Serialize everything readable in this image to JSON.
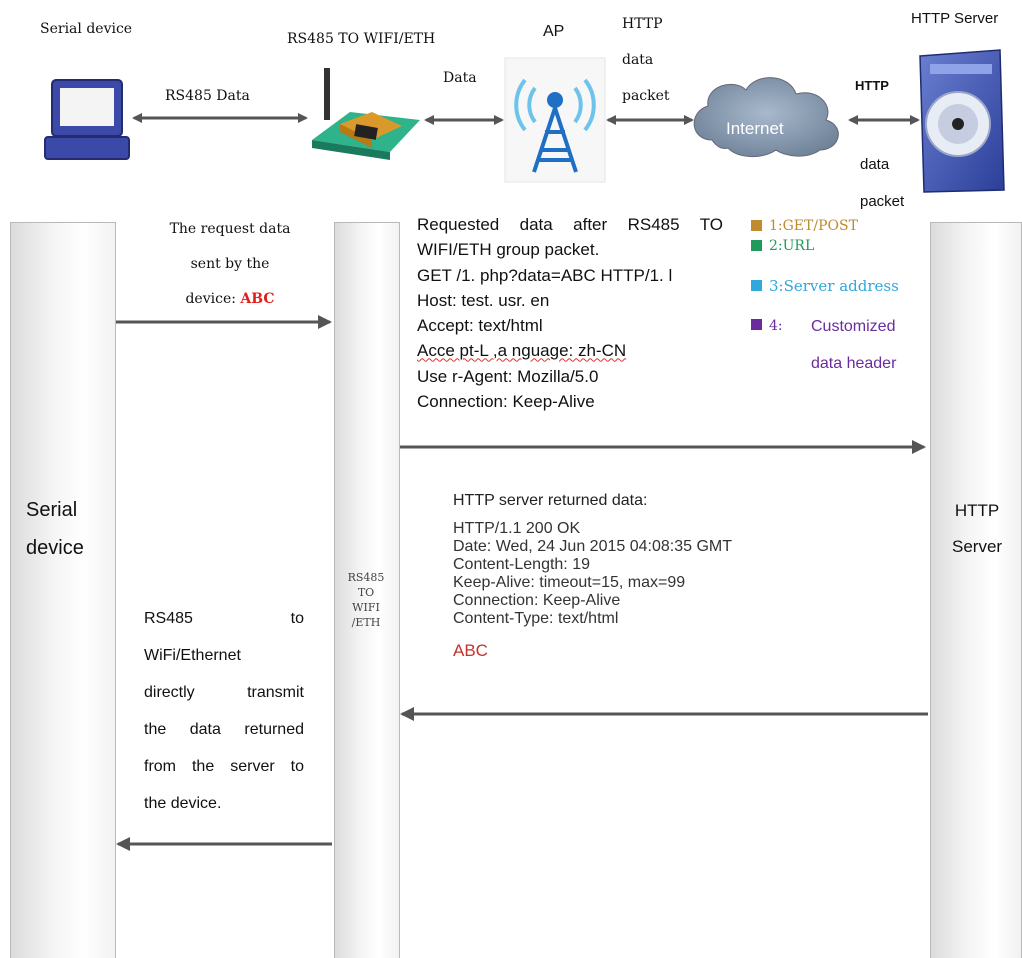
{
  "top": {
    "serial_device_label": "Serial device",
    "converter_label": "RS485 TO WIFI/ETH",
    "ap_label": "AP",
    "http_server_label": "HTTP Server",
    "rs485_data_label": "RS485 Data",
    "data_label": "Data",
    "http_data_packet_lines": [
      "HTTP",
      "data",
      "packet"
    ],
    "internet_label": "Internet",
    "http_bold_label": "HTTP",
    "data_packet_lines": [
      "data",
      "packet"
    ]
  },
  "lifelines": {
    "serial_device_lines": [
      "Serial",
      "device"
    ],
    "converter_lines": [
      "RS485",
      "TO",
      "WIFI",
      "/ETH"
    ],
    "http_server_lines": [
      "HTTP",
      "Server"
    ]
  },
  "request_note": {
    "lines": [
      "The request data",
      "sent by the"
    ],
    "prefix": "device: ",
    "highlight": "ABC"
  },
  "request_packet": {
    "heading": [
      "Requested data after RS485 TO",
      "WIFI/ETH group packet."
    ],
    "lines": [
      "GET /1. php?data=ABC HTTP/1. l",
      "Host: test. usr. en",
      "Accept: text/html",
      "Acce pt-L ,a nguage: zh-CN",
      "Use r-Agent: Mozilla/5.0",
      "Connection: Keep-Alive"
    ]
  },
  "legend": [
    {
      "label": "1:GET/POST",
      "color": "#c08a2e"
    },
    {
      "label": "2:URL",
      "color": "#1f9a5a"
    },
    {
      "label": "3:Server address",
      "color": "#2fa8dc"
    },
    {
      "label": "4:",
      "extra": "Customized",
      "extra2": "data header",
      "color": "#6a2c9c"
    }
  ],
  "response": {
    "heading": "HTTP server returned data:",
    "lines": [
      "HTTP/1.1 200 OK",
      "Date: Wed, 24 Jun 2015 04:08:35 GMT",
      "Content-Length: 19",
      "Keep-Alive: timeout=15, max=99",
      "Connection: Keep-Alive",
      "Content-Type: text/html"
    ],
    "body": "ABC"
  },
  "return_note": {
    "line1_left": "RS485",
    "line1_right": "to",
    "lines": [
      "WiFi/Ethernet",
      "directly transmit",
      "the data returned",
      "from the server to",
      "the device."
    ]
  },
  "colors": {
    "arrow": "#555555",
    "highlight_red": "#e0201b",
    "response_red": "#c8302c",
    "legend_purple": "#6a2c9c"
  }
}
